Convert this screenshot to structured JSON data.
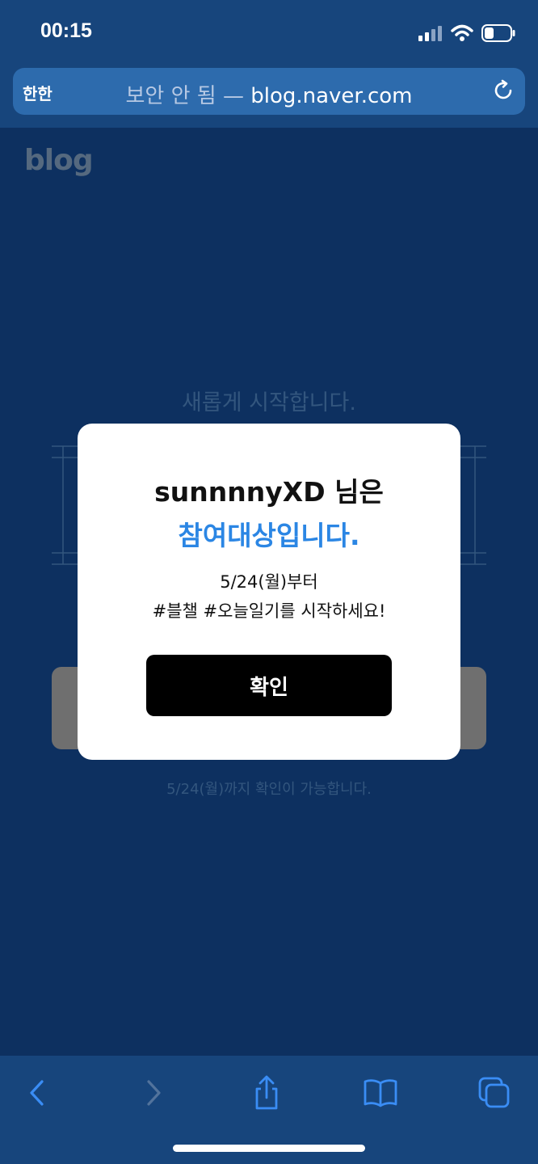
{
  "status_bar": {
    "time": "00:15"
  },
  "browser": {
    "aa_label": "한한",
    "url_insecure": "보안 안 됨 —",
    "url_domain": "blog.naver.com"
  },
  "page": {
    "logo": "blog",
    "heading": "새롭게 시작합니다.",
    "note": "5/24(월)까지 확인이 가능합니다."
  },
  "modal": {
    "title": "sunnnnyXD 님은",
    "title_accent": "참여대상입니다.",
    "line1": "5/24(월)부터",
    "line2": "#블챌 #오늘일기를 시작하세요!",
    "confirm_label": "확인"
  },
  "colors": {
    "accent": "#2b86e4",
    "chrome": "#17457c",
    "page_bg": "#0d3060"
  }
}
